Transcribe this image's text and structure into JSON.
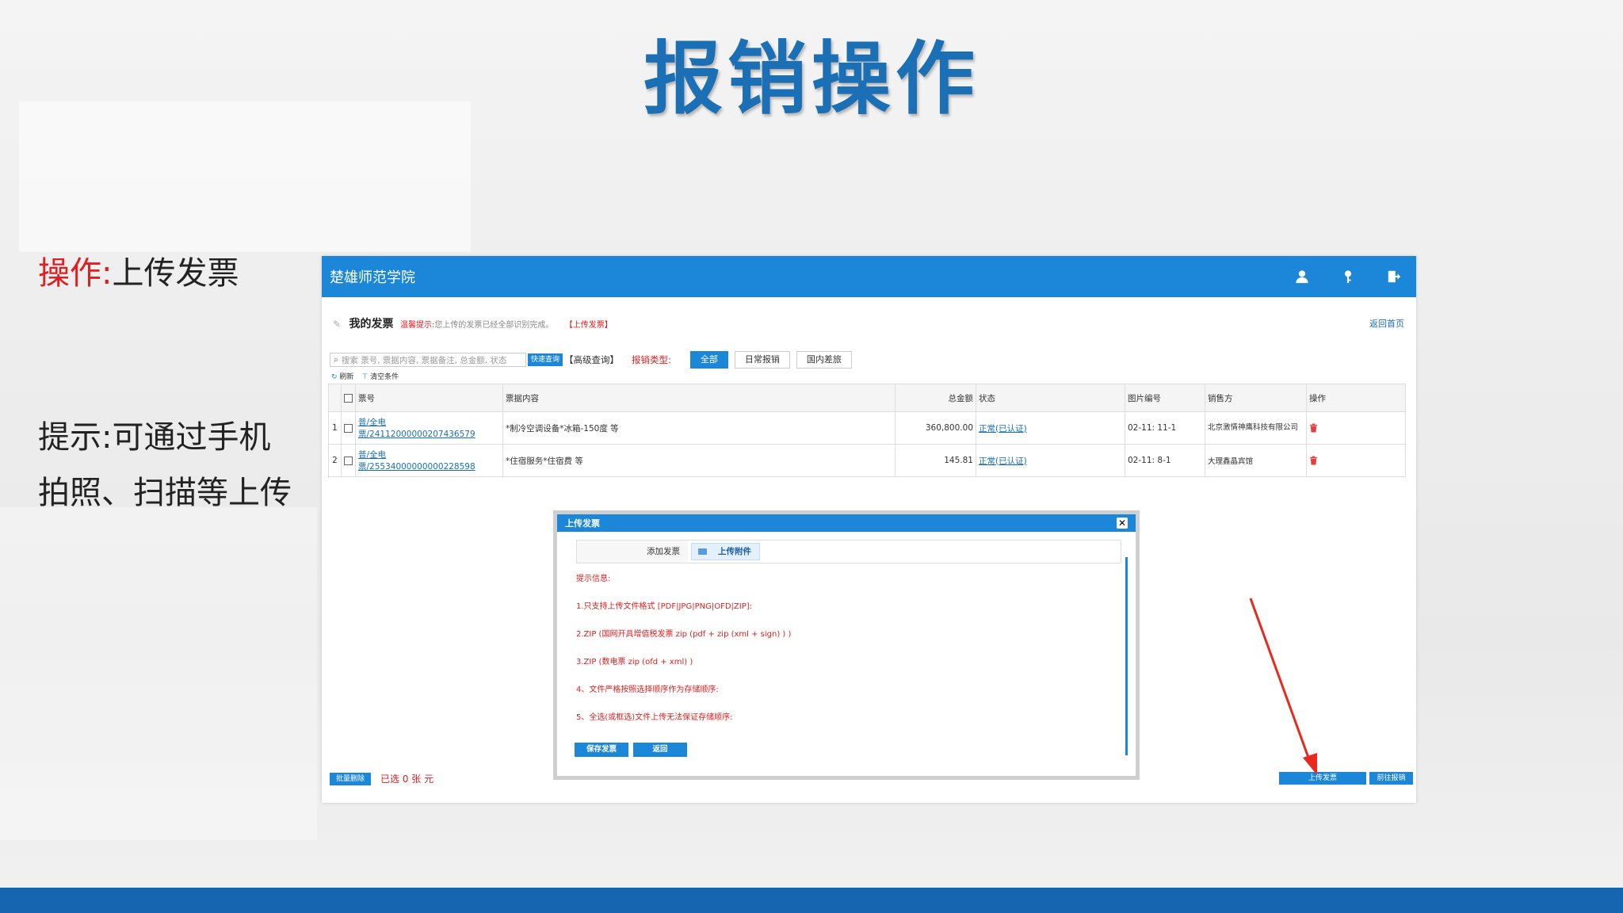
{
  "slide": {
    "title": "报销操作",
    "op_label": "操作:",
    "op_value": "上传发票",
    "hint_line1": "提示:可通过手机",
    "hint_line2": "拍照、扫描等上传"
  },
  "app": {
    "brand": "楚雄师范学院",
    "header_icons": [
      "user-icon",
      "key-icon",
      "logout-icon"
    ],
    "page_title": "我的发票",
    "tip_label": "温馨提示:",
    "tip_text": "您上传的发票已经全部识别完成。",
    "upload_link": "【上传发票】",
    "home_link": "返回首页",
    "search": {
      "placeholder": "搜索 票号, 票据内容, 票据备注, 总金额, 状态",
      "quick_btn": "快速查询",
      "advanced": "【高级查询】",
      "type_label": "报销类型:",
      "tabs": [
        "全部",
        "日常报销",
        "国内差旅"
      ]
    },
    "sub_actions": {
      "refresh": "刷新",
      "clear": "清空条件"
    },
    "table": {
      "headers": [
        "",
        "",
        "票号",
        "票据内容",
        "总金额",
        "状态",
        "图片编号",
        "销售方",
        "操作"
      ],
      "rows": [
        {
          "idx": "1",
          "ticket": "普/全电票/24112000000207436579",
          "content": "*制冷空调设备*冰箱-150度 等",
          "amount": "360,800.00",
          "status": "正常(已认证)",
          "image_no": "02-11: 11-1",
          "seller": "北京激情神鹰科技有限公司"
        },
        {
          "idx": "2",
          "ticket": "普/全电票/25534000000000228598",
          "content": "*住宿服务*住宿费 等",
          "amount": "145.81",
          "status": "正常(已认证)",
          "image_no": "02-11: 8-1",
          "seller": "大理鑫晶宾馆"
        }
      ]
    },
    "footer": {
      "batch_delete": "批量删除",
      "selected": "已选 0 张 元",
      "upload_invoice": "上传发票",
      "submit": "前往报销"
    }
  },
  "modal": {
    "title": "上传发票",
    "add_label": "添加发票",
    "upload_btn": "上传附件",
    "tips_title": "提示信息:",
    "tips": [
      "1.只支持上传文件格式 [PDF|JPG|PNG|OFD|ZIP]:",
      "2.ZIP (国网开具增值税发票 zip (pdf + zip (xml + sign) ) )",
      "3.ZIP (数电票 zip (ofd + xml) )",
      "4、文件严格按照选择顺序作为存储顺序:",
      "5、全选(或框选)文件上传无法保证存储顺序:"
    ],
    "save_btn": "保存发票",
    "back_btn": "返回"
  },
  "colors": {
    "title_blue": "#1a6fb5",
    "header_blue": "#1c87d8",
    "accent_red": "#e02020",
    "bottom_bar": "#1565b0"
  }
}
